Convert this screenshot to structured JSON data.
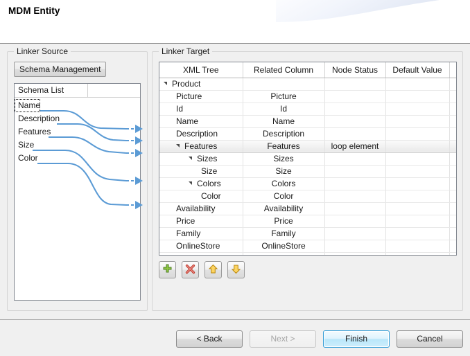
{
  "window": {
    "title": "MDM Entity"
  },
  "source_panel": {
    "legend": "Linker Source",
    "schema_button": "Schema Management",
    "list_headers": [
      "Schema List",
      ""
    ],
    "items": [
      {
        "label": "Name",
        "focused": true
      },
      {
        "label": "Description",
        "focused": false
      },
      {
        "label": "Features",
        "focused": false
      },
      {
        "label": "Size",
        "focused": false
      },
      {
        "label": "Color",
        "focused": false
      }
    ]
  },
  "target_panel": {
    "legend": "Linker Target",
    "columns": [
      "XML Tree",
      "Related Column",
      "Node Status",
      "Default Value",
      ""
    ],
    "rows": [
      {
        "tree": "Product",
        "indent": 0,
        "expander": true,
        "related": "",
        "status": "",
        "default": "",
        "selected": false
      },
      {
        "tree": "Picture",
        "indent": 1,
        "expander": false,
        "related": "Picture",
        "status": "",
        "default": "",
        "selected": false
      },
      {
        "tree": "Id",
        "indent": 1,
        "expander": false,
        "related": "Id",
        "status": "",
        "default": "",
        "selected": false
      },
      {
        "tree": "Name",
        "indent": 1,
        "expander": false,
        "related": "Name",
        "status": "",
        "default": "",
        "selected": false
      },
      {
        "tree": "Description",
        "indent": 1,
        "expander": false,
        "related": "Description",
        "status": "",
        "default": "",
        "selected": false
      },
      {
        "tree": "Features",
        "indent": 1,
        "expander": true,
        "related": "Features",
        "status": "loop element",
        "default": "",
        "selected": true
      },
      {
        "tree": "Sizes",
        "indent": 2,
        "expander": true,
        "related": "Sizes",
        "status": "",
        "default": "",
        "selected": false
      },
      {
        "tree": "Size",
        "indent": 3,
        "expander": false,
        "related": "Size",
        "status": "",
        "default": "",
        "selected": false
      },
      {
        "tree": "Colors",
        "indent": 2,
        "expander": true,
        "related": "Colors",
        "status": "",
        "default": "",
        "selected": false
      },
      {
        "tree": "Color",
        "indent": 3,
        "expander": false,
        "related": "Color",
        "status": "",
        "default": "",
        "selected": false
      },
      {
        "tree": "Availability",
        "indent": 1,
        "expander": false,
        "related": "Availability",
        "status": "",
        "default": "",
        "selected": false
      },
      {
        "tree": "Price",
        "indent": 1,
        "expander": false,
        "related": "Price",
        "status": "",
        "default": "",
        "selected": false
      },
      {
        "tree": "Family",
        "indent": 1,
        "expander": false,
        "related": "Family",
        "status": "",
        "default": "",
        "selected": false
      },
      {
        "tree": "OnlineStore",
        "indent": 1,
        "expander": false,
        "related": "OnlineStore",
        "status": "",
        "default": "",
        "selected": false
      },
      {
        "tree": "",
        "indent": 0,
        "expander": false,
        "related": "",
        "status": "",
        "default": "",
        "selected": false
      }
    ],
    "toolbar": [
      {
        "icon": "add-icon",
        "color": "#6aa83c"
      },
      {
        "icon": "delete-icon",
        "color": "#d9534f"
      },
      {
        "icon": "move-up-icon",
        "color": "#e0a92b"
      },
      {
        "icon": "move-down-icon",
        "color": "#e0a92b"
      }
    ]
  },
  "footer": {
    "back": "< Back",
    "next": "Next >",
    "finish": "Finish",
    "cancel": "Cancel"
  },
  "colors": {
    "connector": "#5b9bd5",
    "header_swoosh": "#dde4f2",
    "accent": "#2f9bd6"
  }
}
